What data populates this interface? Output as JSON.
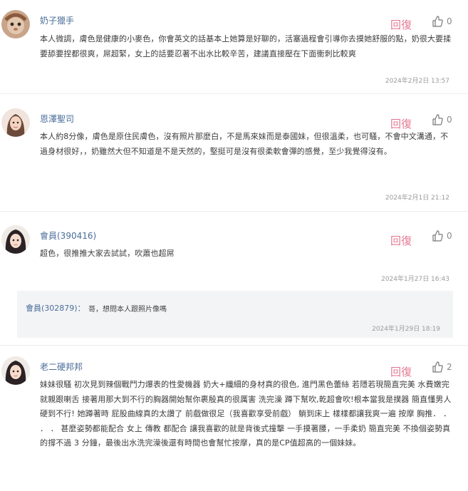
{
  "reply_label": "回復",
  "comments": [
    {
      "username": "奶子獵手",
      "likes": "0",
      "body": "本人微調，膚色是健康的小麥色，你會英文的話基本上她算是好聊的，活塞過程會引導你去摸她舒服的點，奶很大要揉要舔要捏都很爽，屌超緊，女上的話要忍著不出水比較辛苦，建議直接壓在下面衝刺比較爽",
      "date": "2024年2月2日 13:57"
    },
    {
      "username": "恩澤聖司",
      "likes": "0",
      "body": "本人約8分像，膚色是原住民膚色，沒有照片那麼白，不是馬來妹而是泰國妹，但很溫柔，也可騷，不會中文溝通，不過身材很好，，奶雖然大但不知道是不是天然的，堅挺可是沒有很柔軟會彈的感覺，至少我覺得沒有。",
      "date": "2024年2月1日 21:12"
    },
    {
      "username": "會員(390416)",
      "likes": "0",
      "body": "超色，很推推大家去試試，吹蕭也超屌",
      "date": "2024年1月27日 16:43"
    },
    {
      "username": "老二硬邦邦",
      "likes": "2",
      "body": "妹妹很騷 初次見到辣個戰鬥力爆表的性愛機器 奶大+纖細的身材真的很色, 進門黑色蕾絲 若隱若現簡直完美 水費嫩完就親跟喇舌 接著用那大到不行的胸器開始幫你裹殷真的很厲害 洗完澡 蹲下幫吹,乾超會吹!根本當我是撲器 簡直懂男人 硬到不行! 她蹲著時 屁股曲線真的太讚了 前戲做很足（我喜歡享受前戲） 躺到床上 樣樣都讓我爽一遍 按摩 胸推． ． ． ． 甚麼姿勢都能配合 女上 傳教 都配合 讓我喜歡的就是背後式撞擊 一手摸著腰，一手柔奶 簡直完美 不換個姿勢真的撐不過 3 分鐘，最後出水洗完澡後還有時間也會幫忙按摩，真的是CP值超高的一個妹妹。"
    }
  ],
  "reply": {
    "username": "會員(302879)：",
    "body": "哥，想問本人跟照片像嗎",
    "date": "2024年1月29日 18:19"
  }
}
